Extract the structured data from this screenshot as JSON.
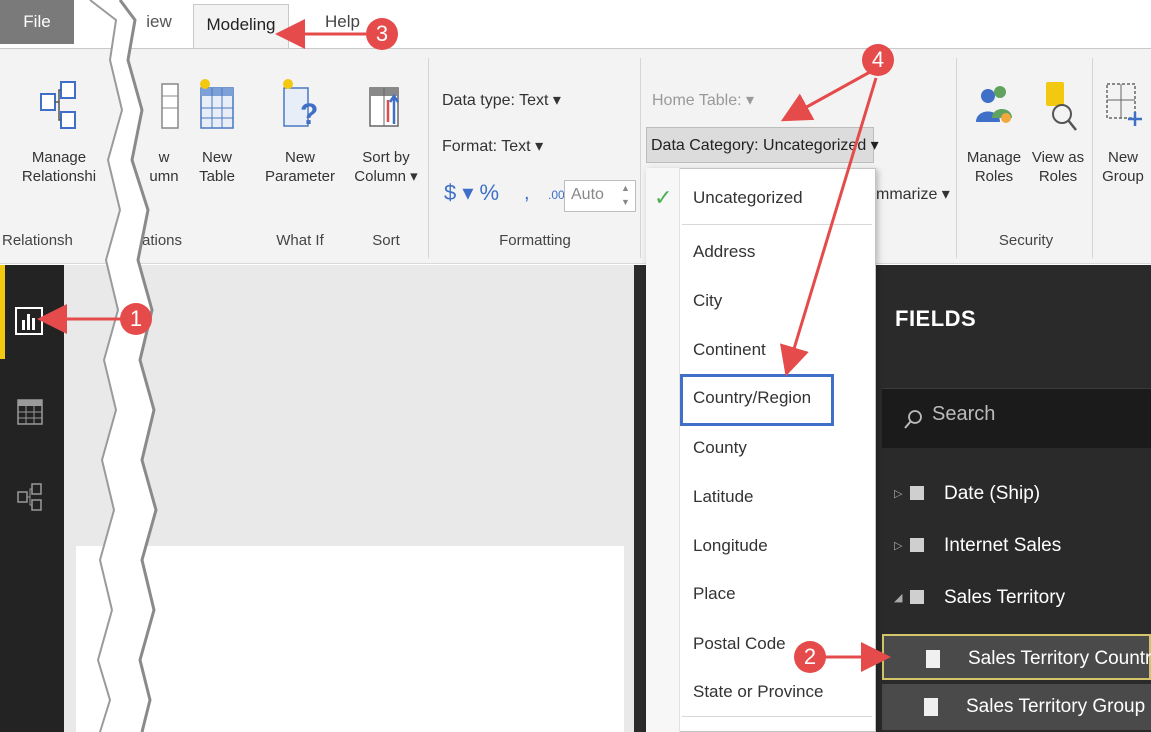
{
  "tabs": {
    "file": "File",
    "view": "iew",
    "modeling": "Modeling",
    "help": "Help"
  },
  "ribbon": {
    "manage_relationships": [
      "Manage",
      "Relationshi"
    ],
    "new_column": [
      "w",
      "umn"
    ],
    "new_table": [
      "New",
      "Table"
    ],
    "new_parameter": [
      "New",
      "Parameter"
    ],
    "sort_by_column": [
      "Sort by",
      "Column ▾"
    ],
    "data_type": "Data type: Text ▾",
    "format": "Format: Text ▾",
    "currency": "$ ▾ %",
    "comma": ",",
    "decimals": ".00",
    "auto": "Auto",
    "home_table": "Home Table: ▾",
    "data_category": "Data Category: Uncategorized ▾",
    "summarize": "mmarize ▾",
    "manage_roles": [
      "Manage",
      "Roles"
    ],
    "view_as_roles": [
      "View as",
      "Roles"
    ],
    "new_group": [
      "New",
      "Group"
    ],
    "groups": {
      "relationships": "Relationsh",
      "calculations": "ations",
      "what_if": "What If",
      "sort": "Sort",
      "formatting": "Formatting",
      "security": "Security"
    }
  },
  "dropdown": {
    "selected": "Uncategorized",
    "items": [
      "Address",
      "City",
      "Continent",
      "Country/Region",
      "County",
      "Latitude",
      "Longitude",
      "Place",
      "Postal Code",
      "State or Province"
    ]
  },
  "fields": {
    "title": "FIELDS",
    "search_placeholder": "Search",
    "tables": [
      "Date (Ship)",
      "Internet Sales",
      "Sales Territory"
    ],
    "columns": [
      "Sales Territory Country",
      "Sales Territory Group"
    ]
  },
  "annotations": [
    "1",
    "2",
    "3",
    "4"
  ],
  "colors": {
    "accent": "#f2c811",
    "annotation": "#e54b4b",
    "highlight": "#3f6fc6",
    "check": "#4caf50"
  }
}
